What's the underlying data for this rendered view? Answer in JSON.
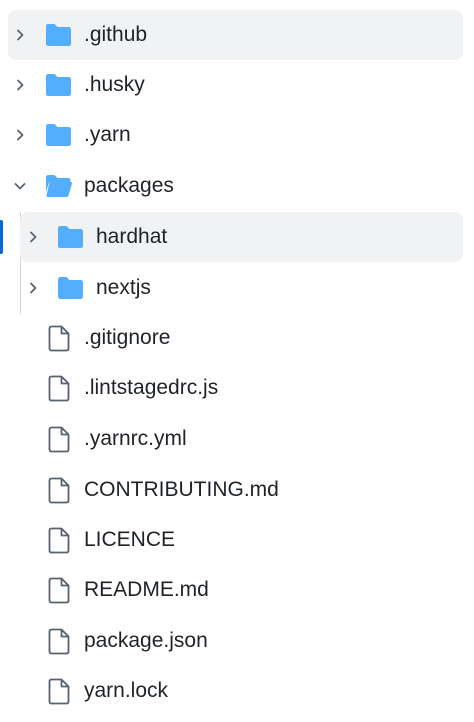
{
  "tree": {
    "items": [
      {
        "label": ".github",
        "kind": "folder",
        "icon": "folder-icon",
        "expanded": false
      },
      {
        "label": ".husky",
        "kind": "folder",
        "icon": "folder-icon",
        "expanded": false
      },
      {
        "label": ".yarn",
        "kind": "folder",
        "icon": "folder-icon",
        "expanded": false
      },
      {
        "label": "packages",
        "kind": "folder",
        "icon": "folder-open-icon",
        "expanded": true
      },
      {
        "label": "hardhat",
        "kind": "folder",
        "icon": "folder-icon",
        "expanded": false,
        "selected": true
      },
      {
        "label": "nextjs",
        "kind": "folder",
        "icon": "folder-icon",
        "expanded": false
      },
      {
        "label": ".gitignore",
        "kind": "file",
        "icon": "file-icon"
      },
      {
        "label": ".lintstagedrc.js",
        "kind": "file",
        "icon": "file-icon"
      },
      {
        "label": ".yarnrc.yml",
        "kind": "file",
        "icon": "file-icon"
      },
      {
        "label": "CONTRIBUTING.md",
        "kind": "file",
        "icon": "file-icon"
      },
      {
        "label": "LICENCE",
        "kind": "file",
        "icon": "file-icon"
      },
      {
        "label": "README.md",
        "kind": "file",
        "icon": "file-icon"
      },
      {
        "label": "package.json",
        "kind": "file",
        "icon": "file-icon"
      },
      {
        "label": "yarn.lock",
        "kind": "file",
        "icon": "file-icon"
      }
    ]
  },
  "colors": {
    "folder": "#54aeff",
    "file_stroke": "#59636e",
    "chevron": "#59636e",
    "hover_bg": "#f1f2f4",
    "accent": "#0969da"
  }
}
